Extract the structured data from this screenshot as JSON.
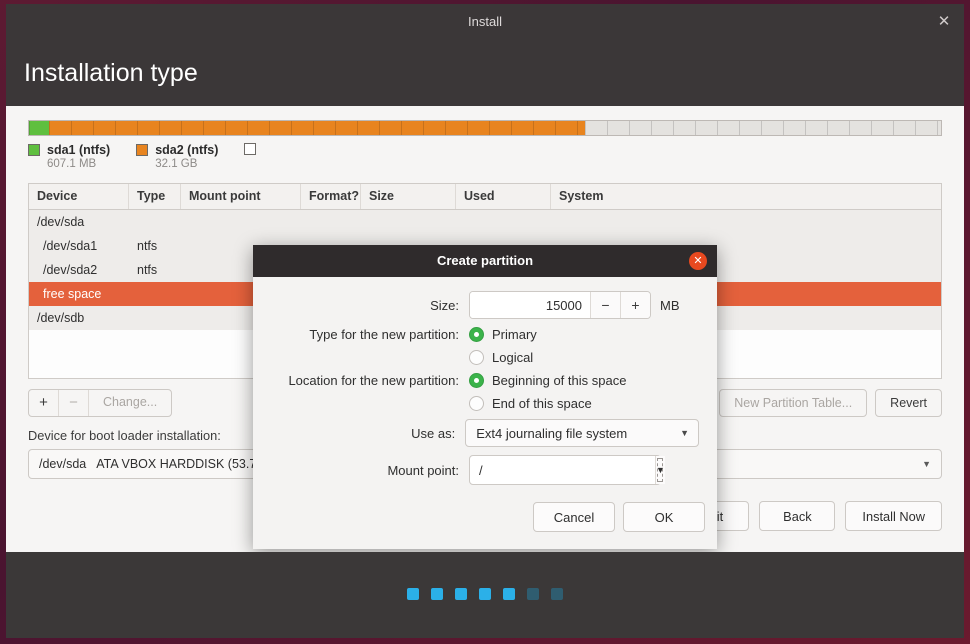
{
  "window": {
    "title": "Install",
    "close_icon": "close-icon",
    "page_title": "Installation type"
  },
  "partition_bar": {
    "segments": [
      {
        "name": "sda1",
        "color": "#5fbf3f",
        "width_pct": 2.2
      },
      {
        "name": "sda2",
        "color": "#e8841f",
        "width_pct": 58.8
      },
      {
        "name": "free space",
        "color": "#e4e2df",
        "width_pct": 39.0
      }
    ]
  },
  "legend": [
    {
      "name": "sda1 (ntfs)",
      "size": "607.1 MB",
      "color": "#5fbf3f"
    },
    {
      "name": "sda2 (ntfs)",
      "size": "32.1 GB",
      "color": "#e8841f"
    },
    {
      "name": "",
      "size": "",
      "color": "#ffffff"
    }
  ],
  "table": {
    "columns": [
      "Device",
      "Type",
      "Mount point",
      "Format?",
      "Size",
      "Used",
      "System"
    ],
    "rows": [
      {
        "device": "/dev/sda",
        "type": "",
        "mount": "",
        "format": "",
        "size": "",
        "used": "",
        "system": "",
        "indent": false,
        "selected": false
      },
      {
        "device": "/dev/sda1",
        "type": "ntfs",
        "mount": "",
        "format": "",
        "size": "",
        "used": "",
        "system": "",
        "indent": true,
        "selected": false
      },
      {
        "device": "/dev/sda2",
        "type": "ntfs",
        "mount": "",
        "format": "",
        "size": "",
        "used": "",
        "system": "",
        "indent": true,
        "selected": false
      },
      {
        "device": "free space",
        "type": "",
        "mount": "",
        "format": "",
        "size": "",
        "used": "",
        "system": "",
        "indent": true,
        "selected": true
      },
      {
        "device": "/dev/sdb",
        "type": "",
        "mount": "",
        "format": "",
        "size": "",
        "used": "",
        "system": "",
        "indent": false,
        "selected": false
      }
    ]
  },
  "table_tools": {
    "add_label": "+",
    "remove_label": "−",
    "change_label": "Change...",
    "new_partition_table_label": "New Partition Table...",
    "revert_label": "Revert"
  },
  "boot_loader": {
    "label": "Device for boot loader installation:",
    "device": "/dev/sda",
    "description": "ATA VBOX HARDDISK (53.7 GB)",
    "arrow_icon": "chevron-down-icon"
  },
  "bottom_buttons": {
    "quit": "Quit",
    "back": "Back",
    "install_now": "Install Now"
  },
  "dialog": {
    "title": "Create partition",
    "close_icon": "close-icon",
    "size": {
      "label": "Size:",
      "value": "15000",
      "minus": "−",
      "plus": "+",
      "unit": "MB"
    },
    "type": {
      "label": "Type for the new partition:",
      "options": [
        "Primary",
        "Logical"
      ],
      "selected": "Primary"
    },
    "location": {
      "label": "Location for the new partition:",
      "options": [
        "Beginning of this space",
        "End of this space"
      ],
      "selected": "Beginning of this space"
    },
    "use_as": {
      "label": "Use as:",
      "value": "Ext4 journaling file system",
      "arrow_icon": "chevron-down-icon"
    },
    "mount_point": {
      "label": "Mount point:",
      "value": "/",
      "arrow_icon": "chevron-down-icon"
    },
    "cancel": "Cancel",
    "ok": "OK"
  },
  "progress_dots": {
    "total": 7,
    "active": 5,
    "active_color": "#2bb0e8",
    "inactive_color": "#2f5d70"
  }
}
